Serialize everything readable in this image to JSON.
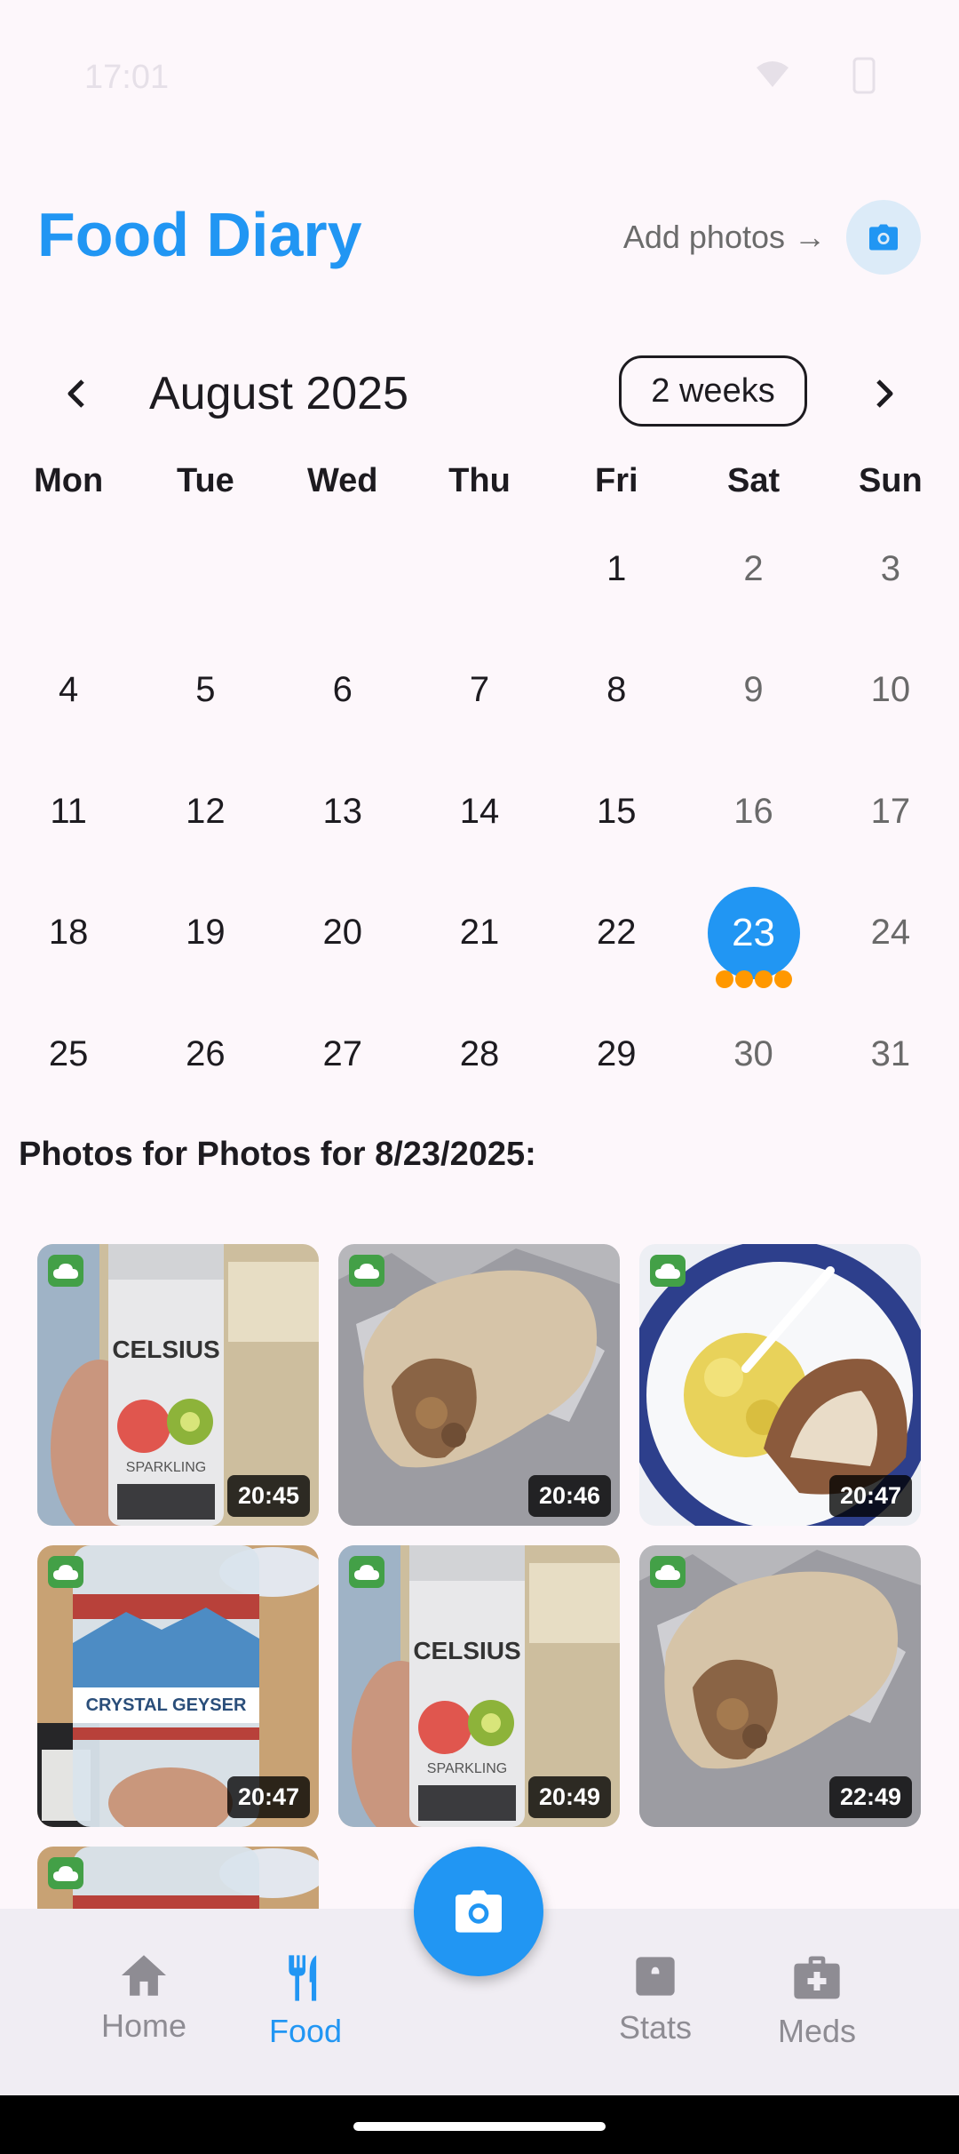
{
  "status_bar": {
    "time": "17:01"
  },
  "header": {
    "title": "Food Diary",
    "add_photos_label": "Add photos →"
  },
  "calendar": {
    "month_label": "August 2025",
    "range_toggle": "2 weeks",
    "weekdays": [
      "Mon",
      "Tue",
      "Wed",
      "Thu",
      "Fri",
      "Sat",
      "Sun"
    ],
    "weeks": [
      [
        "",
        "",
        "",
        "",
        "1",
        "2",
        "3"
      ],
      [
        "4",
        "5",
        "6",
        "7",
        "8",
        "9",
        "10"
      ],
      [
        "11",
        "12",
        "13",
        "14",
        "15",
        "16",
        "17"
      ],
      [
        "18",
        "19",
        "20",
        "21",
        "22",
        "23",
        "24"
      ],
      [
        "25",
        "26",
        "27",
        "28",
        "29",
        "30",
        "31"
      ]
    ],
    "selected_day": "23",
    "selected_day_entries": 4
  },
  "photos": {
    "heading": "Photos for Photos for 8/23/2025:",
    "items": [
      {
        "time": "20:45",
        "subject": "celsius-can"
      },
      {
        "time": "20:46",
        "subject": "burrito"
      },
      {
        "time": "20:47",
        "subject": "croissant-plate"
      },
      {
        "time": "20:47",
        "subject": "water-bottle"
      },
      {
        "time": "20:49",
        "subject": "celsius-can"
      },
      {
        "time": "22:49",
        "subject": "burrito"
      },
      {
        "time": "",
        "subject": "water-bottle"
      }
    ]
  },
  "bottom_nav": {
    "items": [
      {
        "label": "Home",
        "icon": "home-icon"
      },
      {
        "label": "Food",
        "icon": "fork-knife-icon"
      },
      {
        "label": "Stats",
        "icon": "stats-icon"
      },
      {
        "label": "Meds",
        "icon": "medkit-icon"
      }
    ]
  },
  "colors": {
    "accent": "#2196F3",
    "dot": "#FF9800",
    "cloud": "#43A047",
    "background": "#FDF7FB"
  }
}
